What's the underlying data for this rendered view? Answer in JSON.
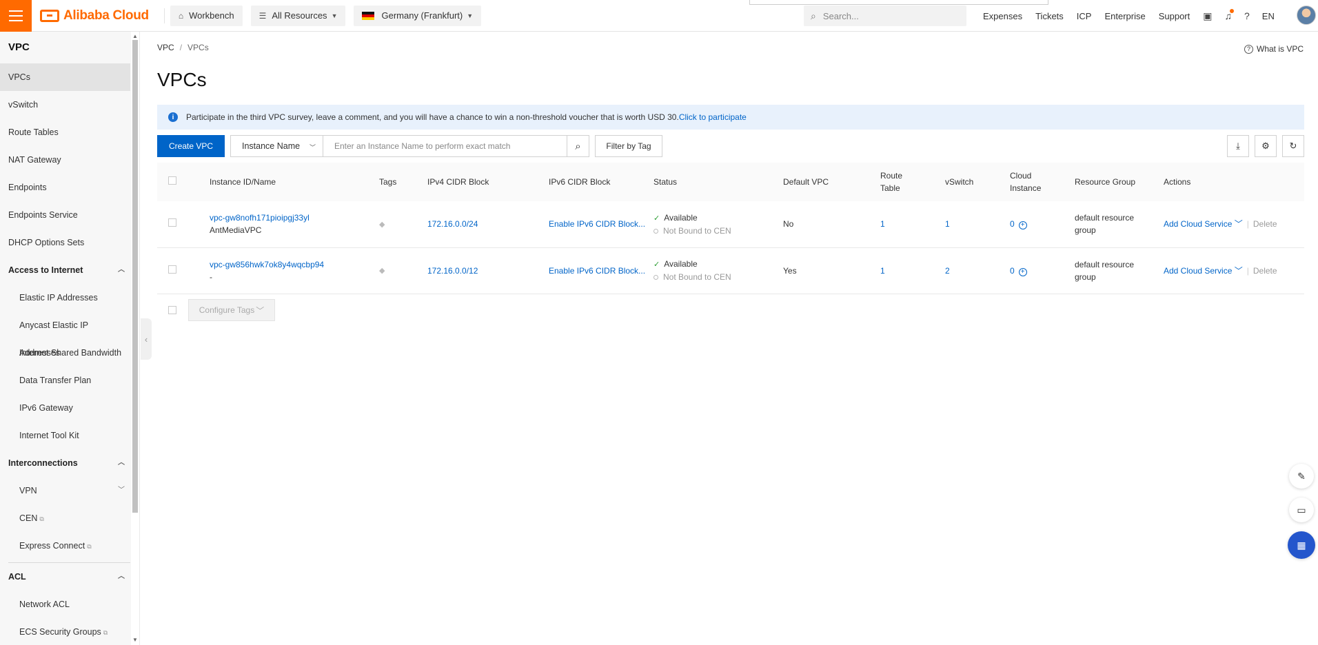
{
  "topbar": {
    "brand": "Alibaba Cloud",
    "workbench": "Workbench",
    "all_resources": "All Resources",
    "region": "Germany (Frankfurt)",
    "search_placeholder": "Search...",
    "nav": [
      "Expenses",
      "Tickets",
      "ICP",
      "Enterprise",
      "Support"
    ],
    "lang": "EN"
  },
  "sidebar": {
    "title": "VPC",
    "items_top": [
      "VPCs",
      "vSwitch",
      "Route Tables",
      "NAT Gateway",
      "Endpoints",
      "Endpoints Service",
      "DHCP Options Sets"
    ],
    "group_access": "Access to Internet",
    "items_access": [
      "Elastic IP Addresses",
      "Anycast Elastic IP Addresses",
      "Internet Shared Bandwidth",
      "Data Transfer Plan",
      "IPv6 Gateway",
      "Internet Tool Kit"
    ],
    "group_inter": "Interconnections",
    "items_inter": [
      "VPN",
      "CEN",
      "Express Connect"
    ],
    "group_acl": "ACL",
    "items_acl": [
      "Network ACL",
      "ECS Security Groups"
    ]
  },
  "main": {
    "breadcrumb": [
      "VPC",
      "VPCs"
    ],
    "what_is": "What is VPC",
    "title": "VPCs",
    "notice_text": "Participate in the third VPC survey, leave a comment, and you will have a chance to win a non-threshold voucher that is worth USD 30.",
    "notice_link": "Click to participate",
    "create_button": "Create VPC",
    "filter_select": "Instance Name",
    "search_placeholder": "Enter an Instance Name to perform exact match",
    "filter_tag": "Filter by Tag",
    "configure_tags": "Configure Tags"
  },
  "table": {
    "columns": [
      "Instance ID/Name",
      "Tags",
      "IPv4 CIDR Block",
      "IPv6 CIDR Block",
      "Status",
      "Default VPC",
      "Route Table",
      "vSwitch",
      "Cloud Instance",
      "Resource Group",
      "Actions"
    ],
    "rows": [
      {
        "id": "vpc-gw8nofh171pioipgj33yl",
        "name": "AntMediaVPC",
        "ipv4": "172.16.0.0/24",
        "ipv6": "Enable IPv6 CIDR Block...",
        "status": "Available",
        "cen": "Not Bound to CEN",
        "default": "No",
        "route": "1",
        "vswitch": "1",
        "cloud": "0",
        "rg": "default resource group",
        "action": "Add Cloud Service",
        "delete": "Delete"
      },
      {
        "id": "vpc-gw856hwk7ok8y4wqcbp94",
        "name": "-",
        "ipv4": "172.16.0.0/12",
        "ipv6": "Enable IPv6 CIDR Block...",
        "status": "Available",
        "cen": "Not Bound to CEN",
        "default": "Yes",
        "route": "1",
        "vswitch": "2",
        "cloud": "0",
        "rg": "default resource group",
        "action": "Add Cloud Service",
        "delete": "Delete"
      }
    ]
  },
  "colors": {
    "brand": "#ff6a00",
    "primary": "#0064c8",
    "notice_bg": "#e8f1fc"
  }
}
